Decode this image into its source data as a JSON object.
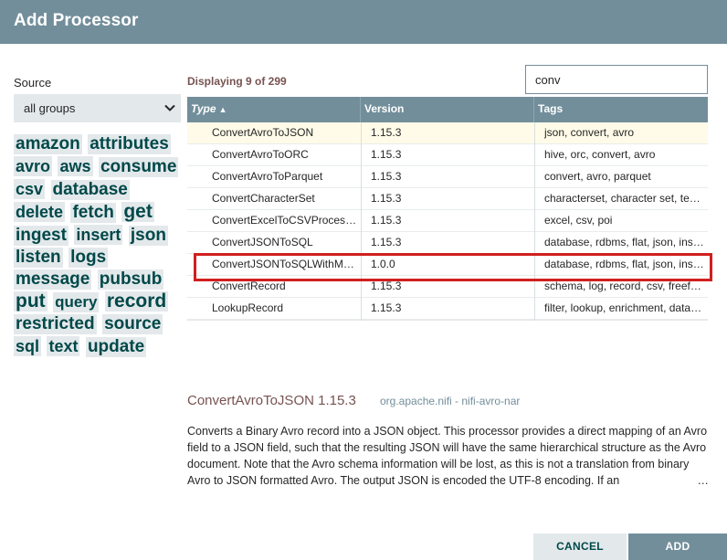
{
  "dialog": {
    "title": "Add Processor"
  },
  "source": {
    "label": "Source",
    "selected": "all groups"
  },
  "tags": [
    {
      "text": "amazon",
      "size": 19
    },
    {
      "text": "attributes",
      "size": 19
    },
    {
      "text": "avro",
      "size": 18
    },
    {
      "text": "aws",
      "size": 18
    },
    {
      "text": "consume",
      "size": 19
    },
    {
      "text": "csv",
      "size": 18
    },
    {
      "text": "database",
      "size": 19
    },
    {
      "text": "delete",
      "size": 18
    },
    {
      "text": "fetch",
      "size": 19
    },
    {
      "text": "get",
      "size": 21
    },
    {
      "text": "ingest",
      "size": 19
    },
    {
      "text": "insert",
      "size": 18
    },
    {
      "text": "json",
      "size": 19
    },
    {
      "text": "listen",
      "size": 19
    },
    {
      "text": "logs",
      "size": 19
    },
    {
      "text": "message",
      "size": 19
    },
    {
      "text": "pubsub",
      "size": 19
    },
    {
      "text": "put",
      "size": 21
    },
    {
      "text": "query",
      "size": 17
    },
    {
      "text": "record",
      "size": 21
    },
    {
      "text": "restricted",
      "size": 19
    },
    {
      "text": "source",
      "size": 19
    },
    {
      "text": "sql",
      "size": 18
    },
    {
      "text": "text",
      "size": 18
    },
    {
      "text": "update",
      "size": 19
    }
  ],
  "results": {
    "count_text": "Displaying 9 of 299"
  },
  "search": {
    "value": "conv"
  },
  "grid": {
    "columns": {
      "type": "Type",
      "version": "Version",
      "tags": "Tags"
    },
    "sort_indicator": "▲",
    "rows": [
      {
        "type": "ConvertAvroToJSON",
        "version": "1.15.3",
        "tags": "json, convert, avro",
        "selected": true
      },
      {
        "type": "ConvertAvroToORC",
        "version": "1.15.3",
        "tags": "hive, orc, convert, avro"
      },
      {
        "type": "ConvertAvroToParquet",
        "version": "1.15.3",
        "tags": "convert, avro, parquet"
      },
      {
        "type": "ConvertCharacterSet",
        "version": "1.15.3",
        "tags": "characterset, character set, text, encoding"
      },
      {
        "type": "ConvertExcelToCSVProcessor",
        "version": "1.15.3",
        "tags": "excel, csv, poi"
      },
      {
        "type": "ConvertJSONToSQL",
        "version": "1.15.3",
        "tags": "database, rdbms, flat, json, insert, update"
      },
      {
        "type": "ConvertJSONToSQLWithMerge",
        "version": "1.0.0",
        "tags": "database, rdbms, flat, json, insert, update"
      },
      {
        "type": "ConvertRecord",
        "version": "1.15.3",
        "tags": "schema, log, record, csv, freeform, avro"
      },
      {
        "type": "LookupRecord",
        "version": "1.15.3",
        "tags": "filter, lookup, enrichment, database"
      }
    ]
  },
  "detail": {
    "name": "ConvertAvroToJSON 1.15.3",
    "bundle": "org.apache.nifi - nifi-avro-nar",
    "description": "Converts a Binary Avro record into a JSON object. This processor provides a direct mapping of an Avro field to a JSON field, such that the resulting JSON will have the same hierarchical structure as the Avro document. Note that the Avro schema information will be lost, as this is not a translation from binary Avro to JSON formatted Avro. The output JSON is encoded the UTF-8 encoding. If an",
    "ellipsis": "…"
  },
  "buttons": {
    "cancel": "CANCEL",
    "add": "ADD"
  },
  "colors": {
    "header": "#728e9b",
    "tag_text": "#004849",
    "tag_bg": "#e3e8eb",
    "accent": "#775351",
    "highlight": "#d0201f",
    "selected_row": "#fffbe8"
  }
}
